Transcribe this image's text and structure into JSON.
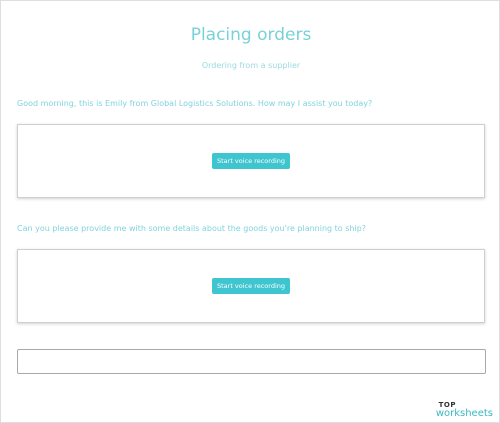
{
  "header": {
    "title": "Placing orders",
    "subtitle": "Ordering from a supplier"
  },
  "questions": [
    {
      "text": "Good morning, this is Emily from Global Logistics Solutions. How may I assist you today?",
      "button_label": "Start voice recording"
    },
    {
      "text": "Can you please provide me with some details about the goods you're planning to ship?",
      "button_label": "Start voice recording"
    }
  ],
  "answer_field": {
    "value": "",
    "placeholder": ""
  },
  "logo": {
    "top": "TOP",
    "bottom": "worksheets"
  },
  "colors": {
    "accent": "#3ec5cf",
    "title": "#77d2d8",
    "question_text": "#80d4da",
    "logo_text": "#3ab8c4"
  }
}
